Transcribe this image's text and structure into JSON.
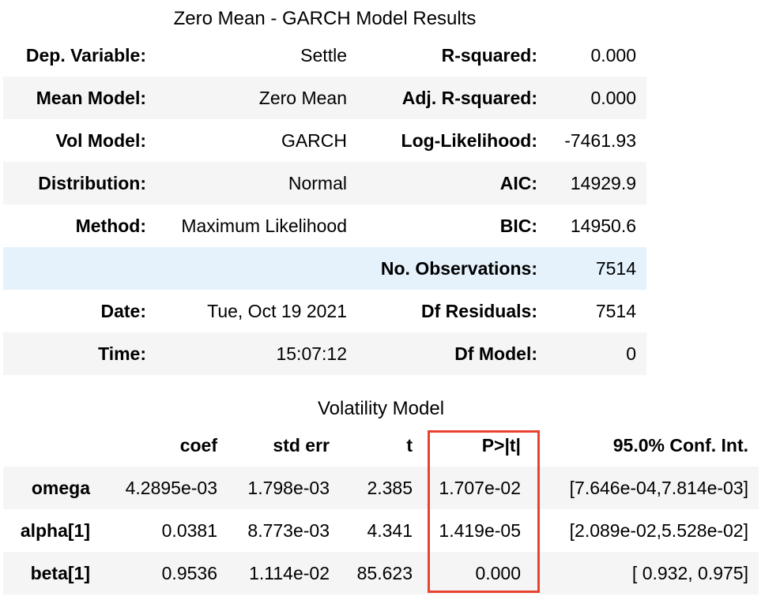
{
  "summary": {
    "caption": "Zero Mean - GARCH Model Results",
    "rows": [
      {
        "l1": "Dep. Variable:",
        "v1": "Settle",
        "l2": "R-squared:",
        "v2": "0.000"
      },
      {
        "l1": "Mean Model:",
        "v1": "Zero Mean",
        "l2": "Adj. R-squared:",
        "v2": "0.000"
      },
      {
        "l1": "Vol Model:",
        "v1": "GARCH",
        "l2": "Log-Likelihood:",
        "v2": "-7461.93"
      },
      {
        "l1": "Distribution:",
        "v1": "Normal",
        "l2": "AIC:",
        "v2": "14929.9"
      },
      {
        "l1": "Method:",
        "v1": "Maximum Likelihood",
        "l2": "BIC:",
        "v2": "14950.6"
      },
      {
        "l1": "",
        "v1": "",
        "l2": "No. Observations:",
        "v2": "7514"
      },
      {
        "l1": "Date:",
        "v1": "Tue, Oct 19 2021",
        "l2": "Df Residuals:",
        "v2": "7514"
      },
      {
        "l1": "Time:",
        "v1": "15:07:12",
        "l2": "Df Model:",
        "v2": "0"
      }
    ]
  },
  "volatility": {
    "caption": "Volatility Model",
    "headers": [
      "",
      "coef",
      "std err",
      "t",
      "P>|t|",
      "95.0% Conf. Int."
    ],
    "rows": [
      {
        "name": "omega",
        "coef": "4.2895e-03",
        "stderr": "1.798e-03",
        "t": "2.385",
        "p": "1.707e-02",
        "ci": "[7.646e-04,7.814e-03]"
      },
      {
        "name": "alpha[1]",
        "coef": "0.0381",
        "stderr": "8.773e-03",
        "t": "4.341",
        "p": "1.419e-05",
        "ci": "[2.089e-02,5.528e-02]"
      },
      {
        "name": "beta[1]",
        "coef": "0.9536",
        "stderr": "1.114e-02",
        "t": "85.623",
        "p": "0.000",
        "ci": "[ 0.932, 0.975]"
      }
    ]
  },
  "colors": {
    "stripe": "#f5f5f5",
    "hover_row": "#e5f2fc",
    "highlight_box": "#e8432f"
  }
}
